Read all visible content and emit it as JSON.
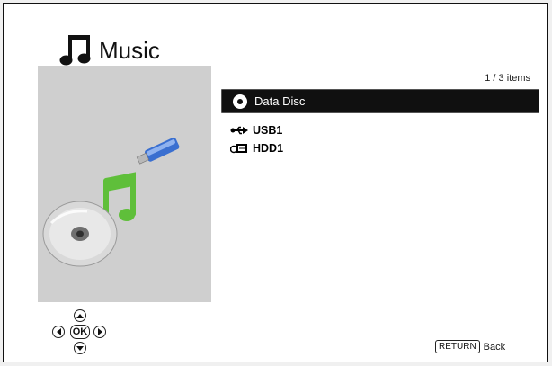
{
  "header": {
    "title": "Music",
    "icon": "music-note-icon"
  },
  "list": {
    "count_text": "1 / 3 items",
    "items": [
      {
        "label": "Data Disc",
        "icon": "disc-icon",
        "selected": true
      },
      {
        "label": "USB1",
        "icon": "usb-icon",
        "selected": false
      },
      {
        "label": "HDD1",
        "icon": "hdd-icon",
        "selected": false
      }
    ]
  },
  "nav": {
    "ok_label": "OK"
  },
  "footer": {
    "return_key": "RETURN",
    "back_label": "Back"
  },
  "colors": {
    "selection_bg": "#101010",
    "panel_bg": "#cfcfcf",
    "note_green": "#5fbf3a",
    "usb_blue": "#3a6fd0"
  }
}
